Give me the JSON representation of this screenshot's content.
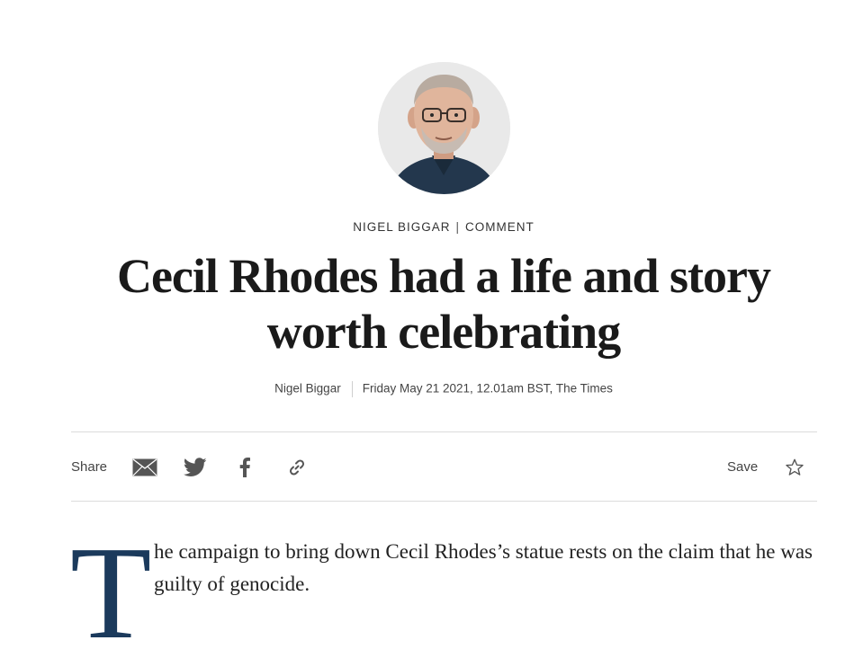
{
  "article": {
    "kicker_author": "NIGEL BIGGAR",
    "kicker_separator": "|",
    "kicker_section": "COMMENT",
    "headline": "Cecil Rhodes had a life and story worth celebrating",
    "byline_author": "Nigel Biggar",
    "byline_date": "Friday May 21 2021, 12.01am BST, The Times",
    "dropcap": "T",
    "body_first": "he campaign to bring down Cecil Rhodes’s statue rests on the claim that he was guilty of genocide."
  },
  "share_bar": {
    "share_label": "Share",
    "save_label": "Save",
    "icons": [
      "email-icon",
      "twitter-icon",
      "facebook-icon",
      "link-icon",
      "star-icon"
    ]
  },
  "colors": {
    "dropcap": "#1b3a5c",
    "text": "#1d1d1b",
    "rule": "#dcdcdc"
  }
}
